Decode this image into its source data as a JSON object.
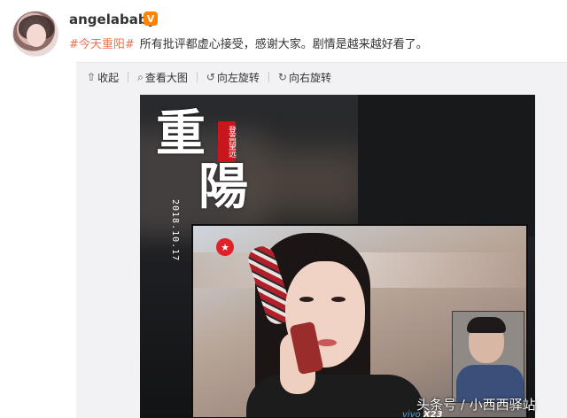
{
  "post": {
    "username": "angelababy",
    "verified_badge": "V",
    "hashtag": "#今天重阳#",
    "text": "所有批评都虚心接受，感谢大家。剧情是越来越好看了。"
  },
  "toolbar": {
    "items": [
      {
        "icon": "collapse-icon",
        "label": "收起"
      },
      {
        "icon": "zoom-icon",
        "label": "查看大图"
      },
      {
        "icon": "rotate-left-icon",
        "label": "向左旋转"
      },
      {
        "icon": "rotate-right-icon",
        "label": "向右旋转"
      }
    ]
  },
  "photo": {
    "poster_char_1": "重",
    "poster_char_2": "陽",
    "seal_text": "登高望远",
    "date": "2018.10.17",
    "station_logo": "★",
    "phone_brand": "vivo",
    "phone_model": "X23"
  },
  "watermark": "头条号 / 小西西驿站",
  "colors": {
    "hashtag": "#eb7350",
    "verified": "#ff8200",
    "toolbar_bg": "#f2f2f5"
  }
}
